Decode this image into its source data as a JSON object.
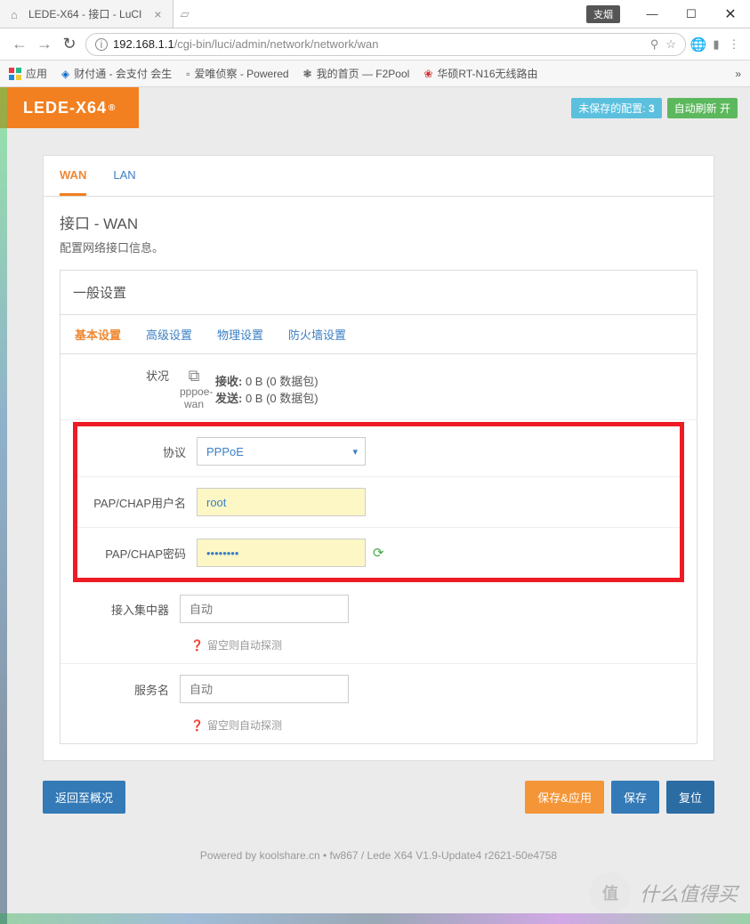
{
  "window": {
    "tab_title": "LEDE-X64 - 接口 - LuCI",
    "user_badge": "支烟"
  },
  "address": {
    "host": "192.168.1.1",
    "path": "/cgi-bin/luci/admin/network/network/wan"
  },
  "bookmarks": {
    "apps": "应用",
    "items": [
      "财付通 - 会支付 会生",
      "爱唯侦察 - Powered",
      "我的首页 — F2Pool",
      "华硕RT-N16无线路由"
    ]
  },
  "brand": "LEDE-X64",
  "header": {
    "unsaved_label": "未保存的配置:",
    "unsaved_count": "3",
    "auto_refresh": "自动刷新 开"
  },
  "top_tabs": {
    "wan": "WAN",
    "lan": "LAN"
  },
  "page": {
    "title": "接口 - WAN",
    "subtitle": "配置网络接口信息。"
  },
  "section": {
    "title": "一般设置",
    "tabs": {
      "basic": "基本设置",
      "advanced": "高级设置",
      "physical": "物理设置",
      "firewall": "防火墙设置"
    }
  },
  "fields": {
    "status": {
      "label": "状况",
      "iface": "pppoe-wan",
      "rx_label": "接收:",
      "rx_value": "0 B (0 数据包)",
      "tx_label": "发送:",
      "tx_value": "0 B (0 数据包)"
    },
    "protocol": {
      "label": "协议",
      "value": "PPPoE"
    },
    "username": {
      "label": "PAP/CHAP用户名",
      "value": "root"
    },
    "password": {
      "label": "PAP/CHAP密码",
      "value": "••••••••"
    },
    "ac": {
      "label": "接入集中器",
      "placeholder": "自动",
      "hint": "留空则自动探测"
    },
    "service": {
      "label": "服务名",
      "placeholder": "自动",
      "hint": "留空则自动探测"
    }
  },
  "actions": {
    "back": "返回至概况",
    "save_apply": "保存&应用",
    "save": "保存",
    "reset": "复位"
  },
  "footer": "Powered by koolshare.cn • fw867 / Lede X64 V1.9-Update4 r2621-50e4758",
  "watermark": "什么值得买"
}
